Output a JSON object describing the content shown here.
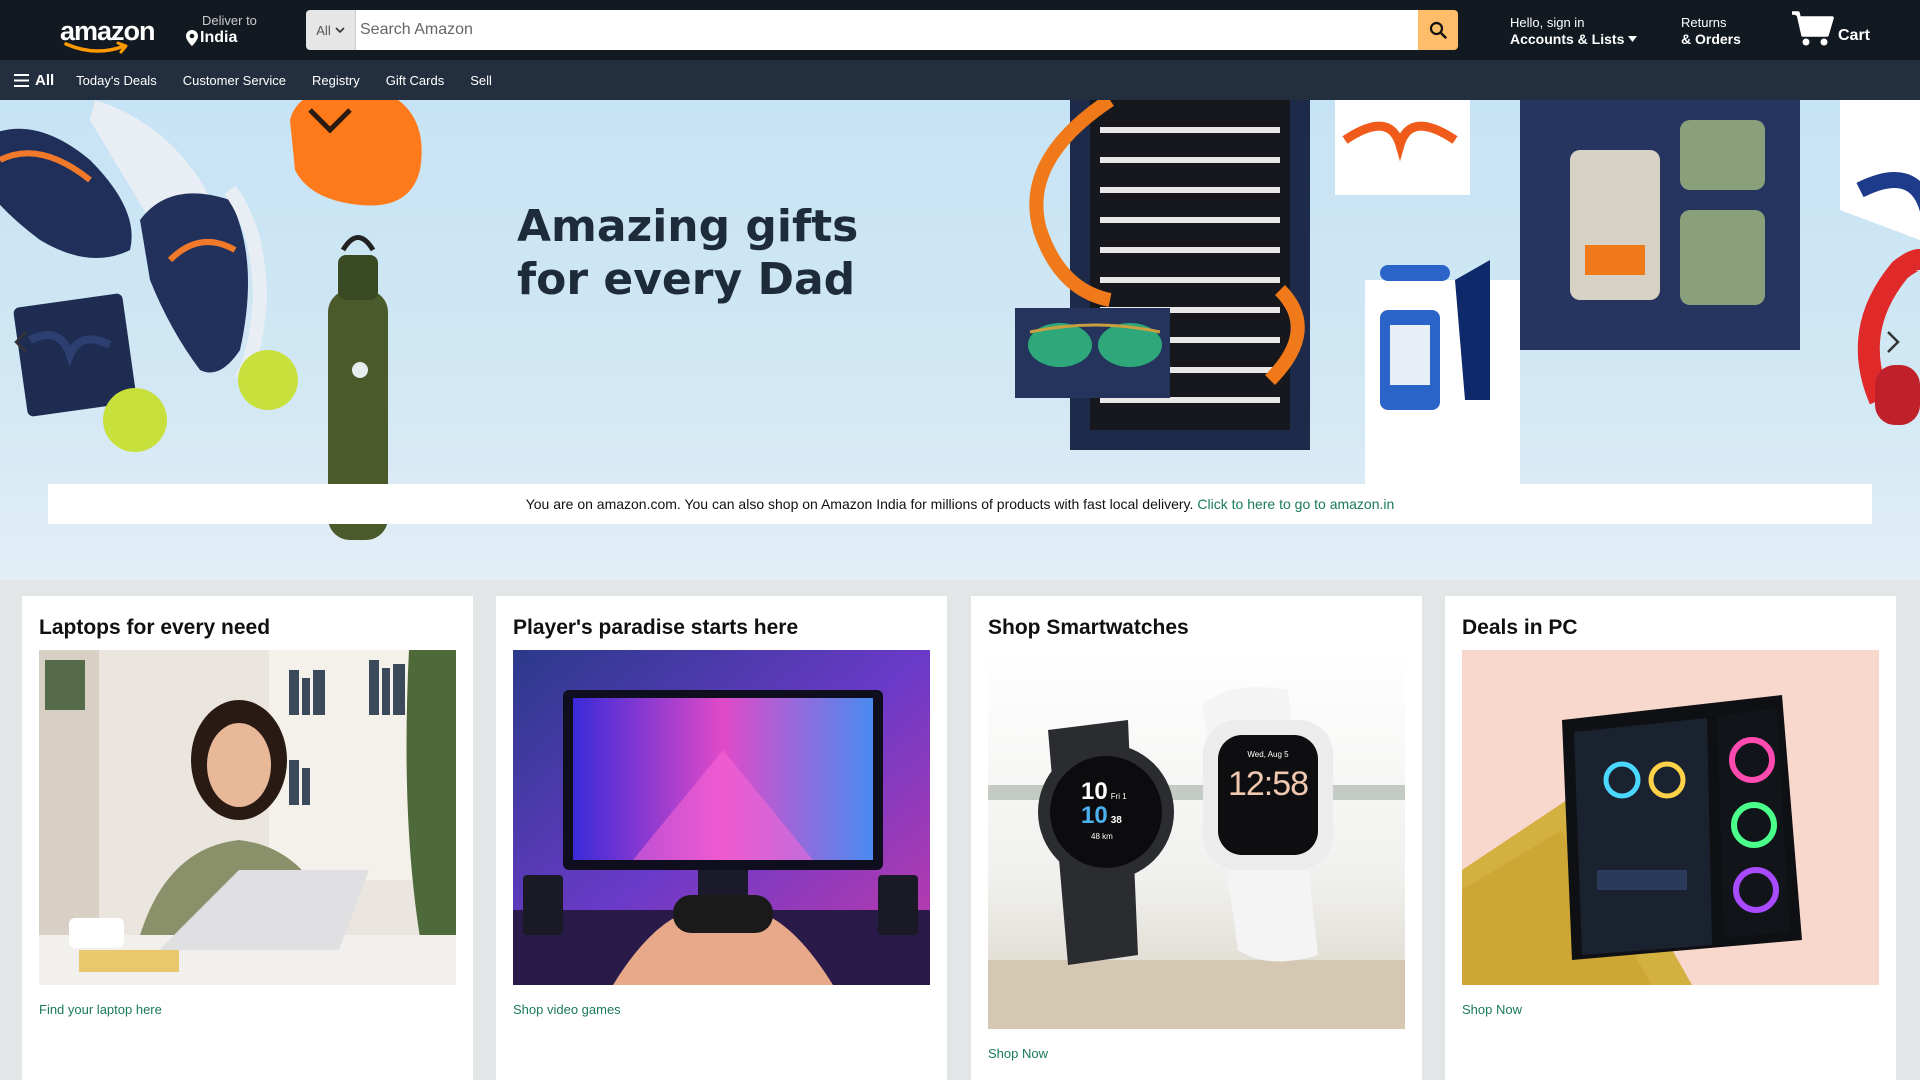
{
  "header": {
    "logo_text": "amazon",
    "deliver_label": "Deliver to",
    "deliver_location": "India",
    "search_category": "All",
    "search_placeholder": "Search Amazon",
    "search_value": "",
    "account_greeting": "Hello, sign in",
    "account_label": "Accounts & Lists",
    "returns_label": "Returns",
    "orders_label": "& Orders",
    "cart_label": "Cart",
    "cart_count": ""
  },
  "subnav": {
    "all_label": "All",
    "links": [
      "Today's Deals",
      "Customer Service",
      "Registry",
      "Gift Cards",
      "Sell"
    ]
  },
  "hero": {
    "title_line1": "Amazing gifts",
    "title_line2": "for every Dad",
    "notice_text": "You are on amazon.com. You can also shop on Amazon India for millions of products with fast local delivery.",
    "notice_link": "Click to here to go to amazon.in"
  },
  "cards": [
    {
      "title": "Laptops for every need",
      "link": "Find your laptop here"
    },
    {
      "title": "Player's paradise starts here",
      "link": "Shop video games"
    },
    {
      "title": "Shop Smartwatches",
      "link": "Shop Now",
      "watch_left_time_h": "10",
      "watch_left_time_m": "10",
      "watch_left_sec": "38",
      "watch_left_date": "Fri 1",
      "watch_left_dist": "48 km",
      "watch_right_time": "12:58",
      "watch_right_date": "Wed, Aug 5"
    },
    {
      "title": "Deals in PC",
      "link": "Shop Now"
    }
  ],
  "colors": {
    "nav_top": "#131921",
    "nav_sub": "#232f3e",
    "search_button": "#febd69",
    "link": "#1a7a5a",
    "page_bg": "#e3e6e6"
  },
  "icons": [
    "location-pin-icon",
    "search-icon",
    "caret-down-icon",
    "cart-icon",
    "hamburger-icon",
    "chevron-left-icon",
    "chevron-right-icon"
  ]
}
